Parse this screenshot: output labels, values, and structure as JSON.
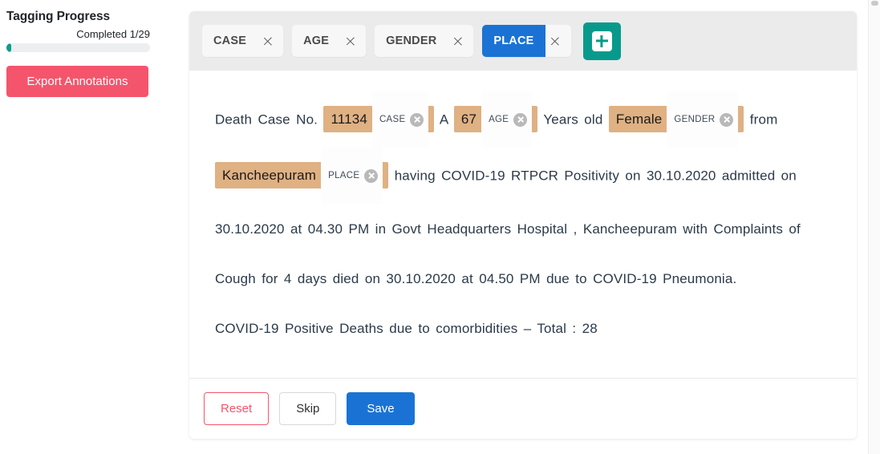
{
  "sidebar": {
    "title": "Tagging Progress",
    "progress_label": "Completed 1/29",
    "progress_percent": 3.4,
    "export_button": "Export Annotations",
    "accent_pink": "#f4556c",
    "accent_teal": "#0f9b8e"
  },
  "header": {
    "tags": [
      {
        "label": "CASE",
        "active": false,
        "close_icon": "close-icon"
      },
      {
        "label": "AGE",
        "active": false,
        "close_icon": "close-icon"
      },
      {
        "label": "GENDER",
        "active": false,
        "close_icon": "close-icon"
      },
      {
        "label": "PLACE",
        "active": true,
        "close_icon": "close-icon"
      }
    ],
    "add_tag_icon": "plus-icon",
    "active_color": "#1a73d4",
    "add_button_color": "#079a8c"
  },
  "document": {
    "highlight_color": "#dfb183",
    "segments": [
      {
        "type": "text",
        "value": "Death Case No."
      },
      {
        "type": "entity",
        "value": "11134",
        "label": "CASE"
      },
      {
        "type": "text",
        "value": "A"
      },
      {
        "type": "entity",
        "value": "67",
        "label": "AGE"
      },
      {
        "type": "text",
        "value": "Years old"
      },
      {
        "type": "entity",
        "value": "Female",
        "label": "GENDER"
      },
      {
        "type": "text",
        "value": "from"
      },
      {
        "type": "entity",
        "value": "Kancheepuram",
        "label": "PLACE"
      },
      {
        "type": "text",
        "value": "having COVID-19 RTPCR Positivity on 30.10.2020 admitted on 30.10.2020 at 04.30 PM in Govt Headquarters Hospital , Kancheepuram with Complaints of Cough for 4 days died on 30.10.2020 at 04.50 PM due to COVID-19 Pneumonia."
      },
      {
        "type": "break"
      },
      {
        "type": "text",
        "value": "COVID-19 Positive Deaths due to comorbidities – Total : 28"
      }
    ]
  },
  "footer": {
    "reset_label": "Reset",
    "skip_label": "Skip",
    "save_label": "Save",
    "save_color": "#1a73d4"
  }
}
